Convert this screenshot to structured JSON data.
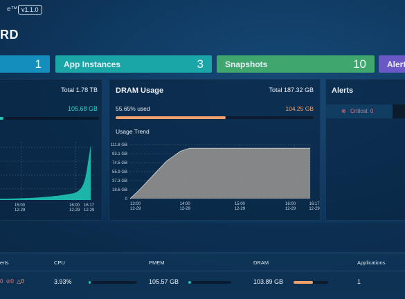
{
  "app": {
    "title_fragment": "e™",
    "version": "v1.1.0"
  },
  "page": {
    "title": "RD"
  },
  "tiles": [
    {
      "label": "",
      "value": "1"
    },
    {
      "label": "App Instances",
      "value": "3"
    },
    {
      "label": "Snapshots",
      "value": "10"
    },
    {
      "label": "Alerts",
      "value": ""
    }
  ],
  "pmem_panel": {
    "total": "Total 1.78 TB",
    "used_value": "105.68 GB",
    "used_fraction": 0.058,
    "x_ticks": [
      {
        "time": "15:00",
        "date": "12-29"
      },
      {
        "time": "16:00",
        "date": "12-29"
      },
      {
        "time": "16:17",
        "date": "12-29"
      }
    ],
    "accent": "#21c6b7"
  },
  "dram_panel": {
    "title": "DRAM Usage",
    "total": "Total 187.32 GB",
    "used_label": "55.65% used",
    "used_value": "104.25 GB",
    "used_fraction": 0.5565,
    "accent": "#f0a06a"
  },
  "alerts_panel": {
    "title": "Alerts",
    "critical": "Critical: 0"
  },
  "chart_data": {
    "type": "area",
    "title": "Usage Trend",
    "xlabel": "",
    "ylabel": "",
    "y_ticks": [
      "111.8 GB",
      "93.1 GB",
      "74.5 GB",
      "55.9 GB",
      "37.3 GB",
      "18.6 GB",
      "0"
    ],
    "y_values": [
      111.8,
      93.1,
      74.5,
      55.9,
      37.3,
      18.6,
      0
    ],
    "ylim": [
      0,
      111.8
    ],
    "x_ticks": [
      {
        "time": "13:00",
        "date": "12-29"
      },
      {
        "time": "14:00",
        "date": "12-29"
      },
      {
        "time": "15:00",
        "date": "12-29"
      },
      {
        "time": "16:00",
        "date": "12-29"
      },
      {
        "time": "16:17",
        "date": "12-29"
      }
    ],
    "x_minutes": [
      0,
      60,
      120,
      180,
      197
    ],
    "series": [
      {
        "points": [
          [
            0,
            0
          ],
          [
            10,
            18
          ],
          [
            25,
            48
          ],
          [
            40,
            78
          ],
          [
            55,
            98
          ],
          [
            65,
            104.25
          ],
          [
            120,
            104.25
          ],
          [
            180,
            104.25
          ],
          [
            197,
            104.25
          ]
        ]
      }
    ],
    "grid": true,
    "colors": {
      "fill": "#8b8b8b",
      "line": "#c9c9c9"
    }
  },
  "table": {
    "headers": [
      "erts",
      "CPU",
      "PMEM",
      "DRAM",
      "Applications"
    ],
    "row": {
      "alerts": [
        "0",
        "0",
        "0"
      ],
      "cpu": "3.93%",
      "cpu_fraction": 0.039,
      "pmem": "105.57 GB",
      "pmem_fraction": 0.06,
      "dram": "103.89 GB",
      "dram_fraction": 0.555,
      "applications": "1"
    }
  }
}
